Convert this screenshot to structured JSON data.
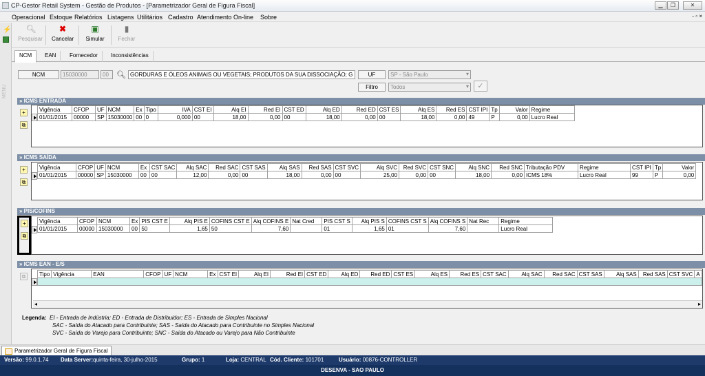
{
  "window": {
    "title": "CP-Gestor Retail System - Gestão de Produtos - [Parametrizador Geral de Figura Fiscal]",
    "min": "▁",
    "max": "❐",
    "close": "✕"
  },
  "menu": {
    "items": [
      "Operacional",
      "Estoque",
      "Relatórios",
      "Listagens",
      "Utilitários",
      "Cadastro",
      "Atendimento On-line",
      "Sobre"
    ],
    "mdi": "- ▫ ×"
  },
  "toolbar": {
    "pesquisar": "Pesquisar",
    "cancelar": "Cancelar",
    "simular": "Simular",
    "fechar": "Fechar"
  },
  "sidebar_vertical": "MENU",
  "tabs": [
    "NCM",
    "EAN",
    "Fornecedor",
    "Inconsistências"
  ],
  "filter": {
    "ncm_label": "NCM",
    "ncm_value": "15030000",
    "ex_value": "00",
    "ncm_desc": "GORDURAS E ÓLEOS ANIMAIS OU VEGETAIS; PRODUTOS DA SUA DISSOCIAÇÃO; G",
    "uf_label": "UF",
    "uf_value": "SP - São Paulo",
    "filtro_label": "Filtro",
    "filtro_value": "Todos",
    "dropdown_glyph": "▾",
    "check_glyph": "✓"
  },
  "sections": {
    "icms_entrada": {
      "title": "» ICMS ENTRADA",
      "columns": [
        "Vigência",
        "CFOP",
        "UF",
        "NCM",
        "Ex",
        "Tipo",
        "IVA",
        "CST EI",
        "Alq EI",
        "Red EI",
        "CST ED",
        "Alq ED",
        "Red ED",
        "CST ES",
        "Alq ES",
        "Red ES",
        "CST IPI",
        "Tp",
        "Valor",
        "Regime"
      ],
      "rows": [
        [
          "01/01/2015",
          "00000",
          "SP",
          "15030000",
          "00",
          "0",
          "0,000",
          "00",
          "18,00",
          "0,00",
          "00",
          "18,00",
          "0,00",
          "00",
          "18,00",
          "0,00",
          "49",
          "P",
          "0,00",
          "Lucro Real"
        ]
      ]
    },
    "icms_saida": {
      "title": "» ICMS SAÍDA",
      "columns": [
        "Vigência",
        "CFOP",
        "UF",
        "NCM",
        "Ex",
        "CST SAC",
        "Alq SAC",
        "Red SAC",
        "CST SAS",
        "Alq SAS",
        "Red SAS",
        "CST SVC",
        "Alq SVC",
        "Red SVC",
        "CST SNC",
        "Alq SNC",
        "Red SNC",
        "Tributação PDV",
        "Regime",
        "CST IPI",
        "Tp",
        "Valor"
      ],
      "rows": [
        [
          "01/01/2015",
          "00000",
          "SP",
          "15030000",
          "00",
          "00",
          "12,00",
          "0,00",
          "00",
          "18,00",
          "0,00",
          "00",
          "25,00",
          "0,00",
          "00",
          "18,00",
          "0,00",
          "ICMS 18%",
          "Lucro Real",
          "99",
          "P",
          "0,00"
        ]
      ]
    },
    "pis_cofins": {
      "title": "» PIS/COFINS",
      "columns": [
        "Vigência",
        "CFOP",
        "NCM",
        "Ex",
        "PIS CST E",
        "Alq PIS E",
        "COFINS CST E",
        "Alq COFINS E",
        "Nat Cred",
        "PIS CST S",
        "Alq PIS S",
        "COFINS CST S",
        "Alq COFINS S",
        "Nat Rec",
        "Regime"
      ],
      "rows": [
        [
          "01/01/2015",
          "00000",
          "15030000",
          "00",
          "50",
          "1,65",
          "50",
          "7,60",
          "",
          "01",
          "1,65",
          "01",
          "7,60",
          "",
          "Lucro Real"
        ]
      ]
    },
    "icms_ean": {
      "title": "» ICMS EAN - E/S",
      "columns": [
        "Tipo",
        "Vigência",
        "EAN",
        "CFOP",
        "UF",
        "NCM",
        "Ex",
        "CST EI",
        "Alq EI",
        "Red EI",
        "CST ED",
        "Alq ED",
        "Red ED",
        "CST ES",
        "Alq ES",
        "Red ES",
        "CST SAC",
        "Alq SAC",
        "Red SAC",
        "CST SAS",
        "Alq SAS",
        "Red SAS",
        "CST SVC",
        "A"
      ],
      "rows": []
    }
  },
  "legend": {
    "label": "Legenda:",
    "line1": "EI - Entrada de Indústria; ED - Entrada de Distribuidor; ES - Entrada de Simples Nacional",
    "line2": "SAC - Saída do Atacado para Contribuinte; SAS - Saída do Atacado para Contribuinte no Simples Nacional",
    "line3": "SVC - Saída do Varejo para Contribuinte; SNC - Saída do Atacado ou Varejo para Não Contribuinte"
  },
  "taskbar": {
    "tab": "Parametrizador Geral de Figura Fiscal"
  },
  "status": {
    "versao_label": "Versão:",
    "versao": "99.0.1.74",
    "data_label": "Data Server:",
    "data": "quinta-feira, 30-julho-2015",
    "grupo_label": "Grupo:",
    "grupo": "1",
    "loja_label": "Loja:",
    "loja": "CENTRAL",
    "cliente_label": "Cód. Cliente:",
    "cliente": "101701",
    "usuario_label": "Usuário:",
    "usuario": "00876-CONTROLLER",
    "footer": "DESENVA - SAO PAULO"
  }
}
